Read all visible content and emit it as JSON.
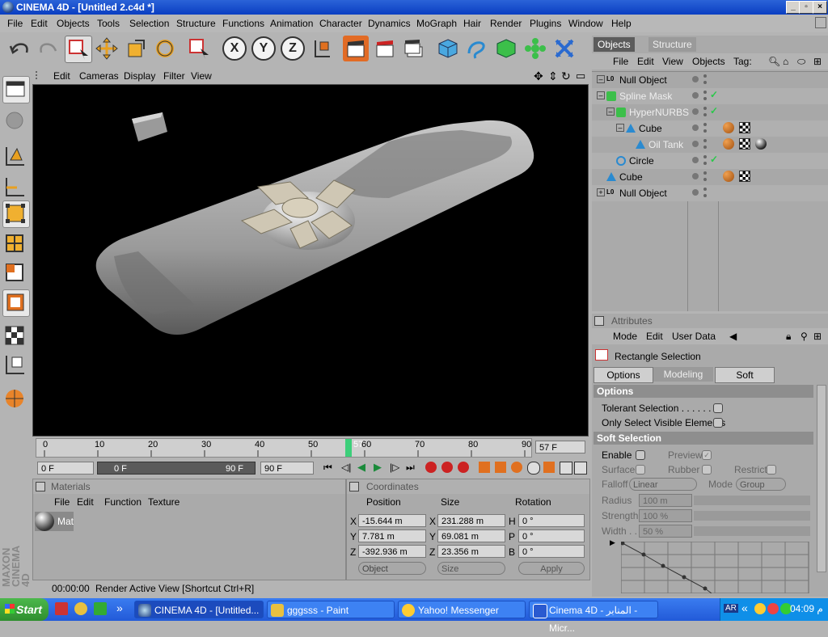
{
  "window": {
    "title": "CINEMA 4D - [Untitled 2.c4d *]"
  },
  "menubar": [
    "File",
    "Edit",
    "Objects",
    "Tools",
    "Selection",
    "Structure",
    "Functions",
    "Animation",
    "Character",
    "Dynamics",
    "MoGraph",
    "Hair",
    "Render",
    "Plugins",
    "Window",
    "Help"
  ],
  "toolbar": {
    "x_label": "X",
    "y_label": "Y",
    "z_label": "Z"
  },
  "viewport": {
    "menu": [
      "Edit",
      "Cameras",
      "Display",
      "Filter",
      "View"
    ]
  },
  "timeline": {
    "ticks": [
      "0",
      "10",
      "20",
      "30",
      "40",
      "50",
      "60",
      "70",
      "80",
      "90"
    ],
    "current_marker": "57",
    "current_field": "57 F",
    "start_field": "0 F",
    "range_start": "0 F",
    "range_end": "90 F",
    "end_field": "90 F"
  },
  "materials": {
    "title": "Materials",
    "menu": [
      "File",
      "Edit",
      "Function",
      "Texture"
    ],
    "items": [
      {
        "name": "Mat"
      }
    ]
  },
  "coordinates": {
    "title": "Coordinates",
    "headers": [
      "Position",
      "Size",
      "Rotation"
    ],
    "rows": [
      {
        "axis": "X",
        "pos": "-15.644 m",
        "saxis": "X",
        "size": "231.288 m",
        "raxis": "H",
        "rot": "0 °"
      },
      {
        "axis": "Y",
        "pos": "7.781 m",
        "saxis": "Y",
        "size": "69.081 m",
        "raxis": "P",
        "rot": "0 °"
      },
      {
        "axis": "Z",
        "pos": "-392.936 m",
        "saxis": "Z",
        "size": "23.356 m",
        "raxis": "B",
        "rot": "0 °"
      }
    ],
    "mode_select": "Object",
    "size_select": "Size",
    "apply_label": "Apply"
  },
  "statusbar": {
    "time": "00:00:00",
    "message": "Render Active View [Shortcut Ctrl+R]"
  },
  "objects_panel": {
    "tabs": [
      "Objects",
      "Structure"
    ],
    "menu": [
      "File",
      "Edit",
      "View",
      "Objects",
      "Tag:"
    ],
    "rows": [
      {
        "name": "Null Object",
        "indent": 0,
        "expander": "–",
        "dim": false,
        "check": false,
        "tags": []
      },
      {
        "name": "Spline Mask",
        "indent": 0,
        "expander": "–",
        "dim": true,
        "check": true,
        "tags": []
      },
      {
        "name": "HyperNURBS",
        "indent": 1,
        "expander": "–",
        "dim": true,
        "check": true,
        "tags": []
      },
      {
        "name": "Cube",
        "indent": 2,
        "expander": "–",
        "dim": false,
        "check": false,
        "tags": [
          "phong",
          "texture"
        ]
      },
      {
        "name": "Oil Tank",
        "indent": 3,
        "expander": "",
        "dim": true,
        "check": false,
        "tags": [
          "phong",
          "texture",
          "material"
        ]
      },
      {
        "name": "Circle",
        "indent": 1,
        "expander": "",
        "dim": false,
        "check": true,
        "tags": []
      },
      {
        "name": "Cube",
        "indent": 0,
        "expander": "",
        "dim": false,
        "check": false,
        "tags": [
          "phong",
          "texture"
        ]
      },
      {
        "name": "Null Object",
        "indent": 0,
        "expander": "+",
        "dim": false,
        "check": false,
        "tags": []
      }
    ]
  },
  "attributes": {
    "title": "Attributes",
    "menu": [
      "Mode",
      "Edit",
      "User Data"
    ],
    "tool_name": "Rectangle Selection",
    "tabs": [
      "Options",
      "Modeling Axis",
      "Soft Selection"
    ],
    "options_title": "Options",
    "tolerant": "Tolerant Selection . . . . . . .",
    "only_visible": "Only Select Visible Elements",
    "soft_title": "Soft Selection",
    "enable": "Enable",
    "preview": "Preview",
    "surface": "Surface",
    "rubber": "Rubber",
    "restrict": "Restrict",
    "falloff_label": "Falloff",
    "falloff_value": "Linear",
    "mode_label": "Mode",
    "mode_value": "Group",
    "radius_label": "Radius",
    "radius_value": "100 m",
    "strength_label": "Strength",
    "strength_value": "100 %",
    "width_label": "Width . .",
    "width_value": "50 %"
  },
  "taskbar": {
    "start": "Start",
    "tasks": [
      "CINEMA 4D - [Untitled...",
      "gggsss - Paint",
      "Yahoo! Messenger",
      "Cinema 4D - المنابر - Micr..."
    ],
    "lang": "AR",
    "clock": "04:09 م"
  },
  "vertical_brand": "MAXON CINEMA 4D"
}
